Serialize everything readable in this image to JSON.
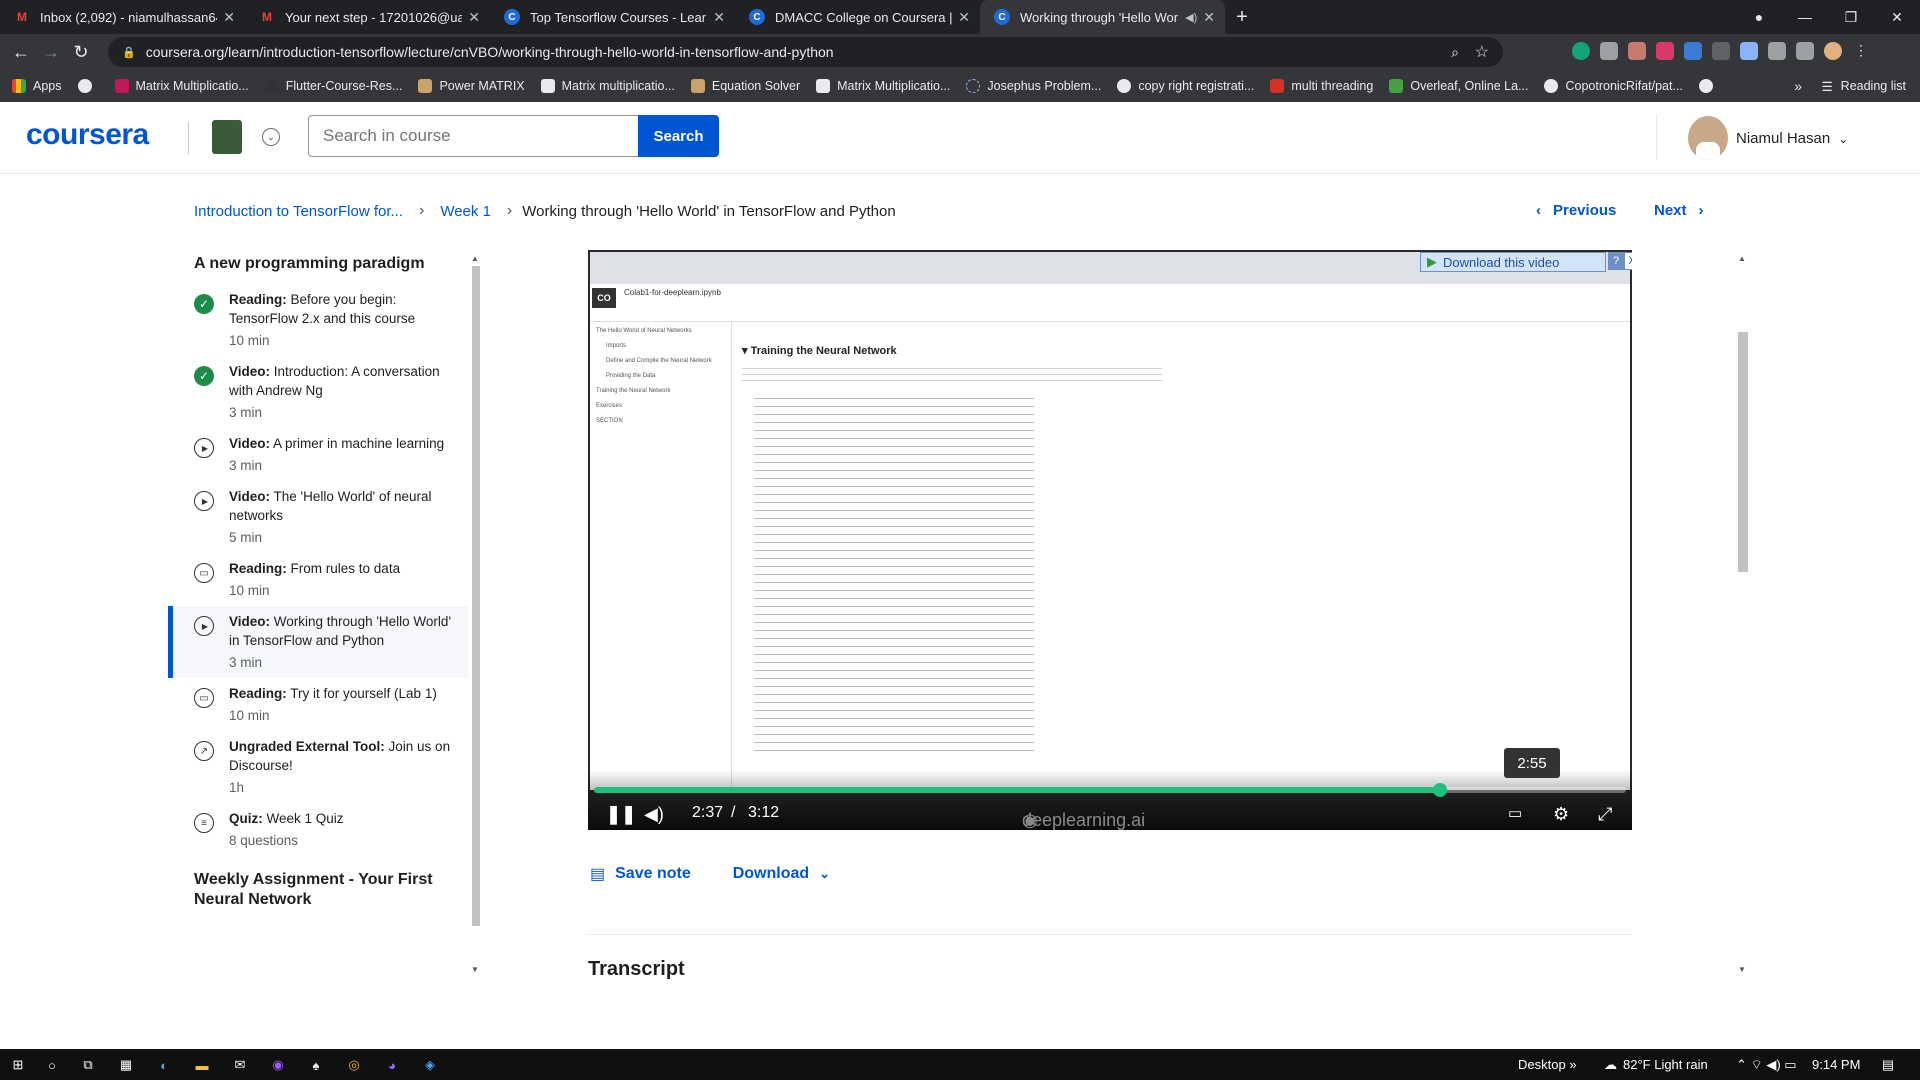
{
  "browser": {
    "tabs": [
      {
        "title": "Inbox (2,092) - niamulhassan64@",
        "favicon": "gmail-icon",
        "active": false
      },
      {
        "title": "Your next step - 17201026@uap-",
        "favicon": "gmail-icon",
        "active": false
      },
      {
        "title": "Top Tensorflow Courses - Learn T",
        "favicon": "coursera-icon",
        "active": false
      },
      {
        "title": "DMACC College on Coursera | Co",
        "favicon": "coursera-icon",
        "active": false
      },
      {
        "title": "Working through 'Hello Wor",
        "favicon": "coursera-icon",
        "active": true
      }
    ],
    "url": "coursera.org/learn/introduction-tensorflow/lecture/cnVBO/working-through-hello-world-in-tensorflow-and-python",
    "bookmarks": [
      "Apps",
      "",
      "Matrix Multiplicatio...",
      "Flutter-Course-Res...",
      "Power MATRIX",
      "Matrix multiplicatio...",
      "Equation Solver",
      "Matrix Multiplicatio...",
      "Josephus Problem...",
      "copy right registrati...",
      "multi threading",
      "Overleaf, Online La...",
      "CopotronicRifat/pat..."
    ],
    "reading_list": "Reading list"
  },
  "header": {
    "logo": "coursera",
    "search_placeholder": "Search in course",
    "search_button": "Search",
    "user_name": "Niamul Hasan"
  },
  "breadcrumb": {
    "course": "Introduction to TensorFlow for...",
    "week": "Week 1",
    "current": "Working through 'Hello World' in TensorFlow and Python"
  },
  "nav": {
    "previous": "Previous",
    "next": "Next"
  },
  "sidebar": {
    "section_title": "A new programming paradigm",
    "items": [
      {
        "type": "Reading:",
        "title": "Before you begin: TensorFlow 2.x and this course",
        "duration": "10 min",
        "status": "done"
      },
      {
        "type": "Video:",
        "title": "Introduction: A conversation with Andrew Ng",
        "duration": "3 min",
        "status": "done"
      },
      {
        "type": "Video:",
        "title": "A primer in machine learning",
        "duration": "3 min",
        "status": "video"
      },
      {
        "type": "Video:",
        "title": "The 'Hello World' of neural networks",
        "duration": "5 min",
        "status": "video"
      },
      {
        "type": "Reading:",
        "title": "From rules to data",
        "duration": "10 min",
        "status": "reading"
      },
      {
        "type": "Video:",
        "title": "Working through 'Hello World' in TensorFlow and Python",
        "duration": "3 min",
        "status": "active"
      },
      {
        "type": "Reading:",
        "title": "Try it for yourself (Lab 1)",
        "duration": "10 min",
        "status": "reading"
      },
      {
        "type": "Ungraded External Tool:",
        "title": "Join us on Discourse!",
        "duration": "1h",
        "status": "external"
      },
      {
        "type": "Quiz:",
        "title": "Week 1 Quiz",
        "duration": "8 questions",
        "status": "quiz"
      }
    ],
    "next_section_title": "Weekly Assignment - Your First Neural Network"
  },
  "video": {
    "download_overlay": "Download this video",
    "download_help": "?",
    "download_close": "X",
    "colab_file": "Colab1-for-deeplearn.ipynb",
    "colab_logo": "CO",
    "toc_items": [
      "The Hello World of Neural Networks",
      "Imports",
      "Define and Compile the Neural Network",
      "Providing the Data",
      "Training the Neural Network",
      "Exercises",
      "SECTION"
    ],
    "notebook_heading": "Training the Neural Network",
    "current_time": "2:37",
    "time_separator": "/",
    "duration": "3:12",
    "hover_time": "2:55",
    "progress_fraction": 0.82,
    "watermark": "deeplearning.ai"
  },
  "actions": {
    "save_note": "Save note",
    "download": "Download"
  },
  "transcript_heading": "Transcript",
  "taskbar": {
    "desktop": "Desktop",
    "weather": "82°F  Light rain",
    "time": "9:14 PM"
  },
  "colors": {
    "brand": "#0056d2",
    "progress": "#1ec17c",
    "complete": "#1e8a4c"
  }
}
